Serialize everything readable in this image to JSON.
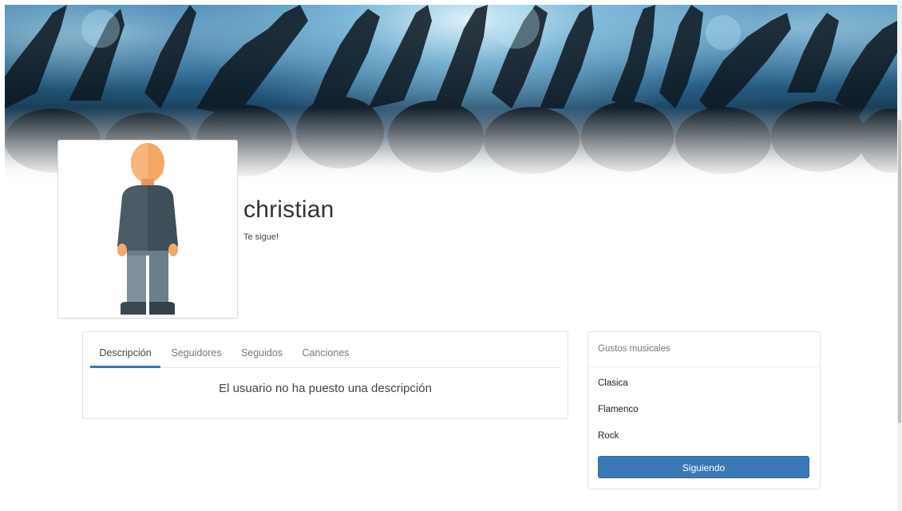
{
  "profile": {
    "username": "christian",
    "follow_status": "Te sigue!"
  },
  "tabs": [
    {
      "label": "Descripción",
      "active": true
    },
    {
      "label": "Seguidores",
      "active": false
    },
    {
      "label": "Seguidos",
      "active": false
    },
    {
      "label": "Canciones",
      "active": false
    }
  ],
  "description_message": "El usuario no ha puesto una descripción",
  "music_tastes": {
    "title": "Gustos musicales",
    "items": [
      "Clasica",
      "Flamenco",
      "Rock"
    ],
    "button_label": "Siguiendo"
  },
  "colors": {
    "accent": "#3a78b5",
    "banner_light": "#9fd6ef",
    "banner_dark": "#0e2536"
  },
  "icons": {
    "avatar": "person-avatar-icon"
  }
}
